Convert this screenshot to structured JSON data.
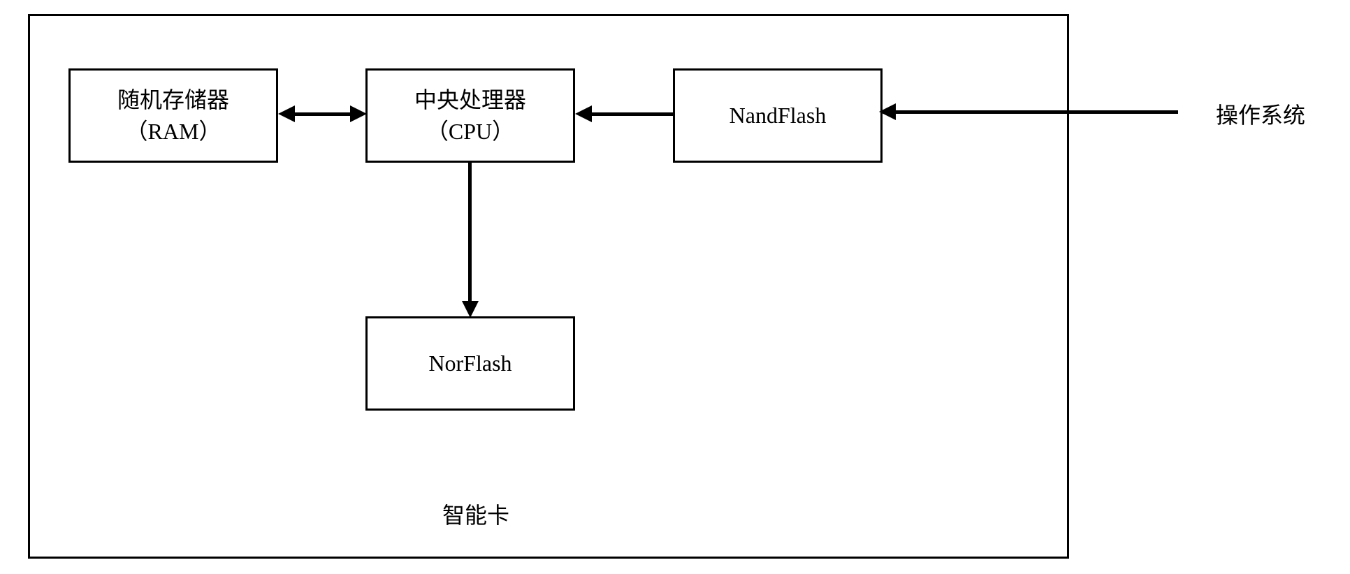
{
  "boxes": {
    "ram": {
      "line1": "随机存储器",
      "line2": "（RAM）"
    },
    "cpu": {
      "line1": "中央处理器",
      "line2": "（CPU）"
    },
    "nandflash": {
      "label": "NandFlash"
    },
    "norflash": {
      "label": "NorFlash"
    }
  },
  "labels": {
    "smartcard": "智能卡",
    "os": "操作系统"
  }
}
